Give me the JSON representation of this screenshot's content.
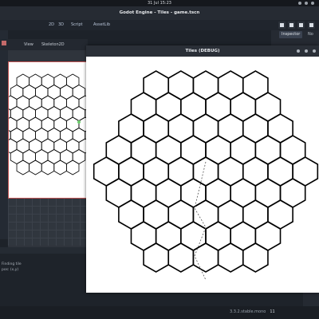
{
  "system": {
    "clock": "31 Jul 15:23"
  },
  "editor": {
    "title": "Godot Engine - Tiles - game.tscn",
    "workspace_tabs": [
      "2D",
      "3D",
      "Script",
      "AssetLib"
    ],
    "canvas_toolbar": [
      "View",
      "Skeleton2D"
    ]
  },
  "dock": {
    "inspector_tab": "Inspector",
    "node_tab": "No"
  },
  "game_window": {
    "title": "Tiles (DEBUG)"
  },
  "output": {
    "lines": [
      "Finding tile",
      "pos: (x,y)"
    ]
  },
  "status": {
    "version": "3.3.2.stable.mono",
    "badge": "11"
  },
  "colors": {
    "hex_line": "#000000",
    "canvas_border": "#c25454",
    "accent": "#8fc1ff"
  },
  "icons": [
    "play-icon",
    "pause-icon",
    "stop-icon",
    "close-icon"
  ]
}
